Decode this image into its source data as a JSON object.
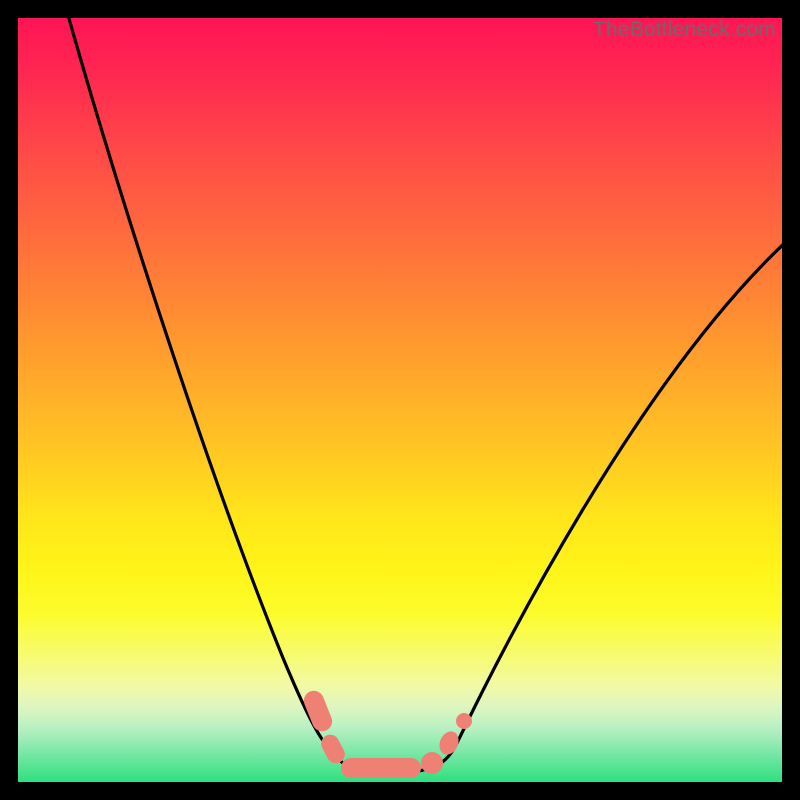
{
  "watermark": {
    "text": "TheBottleneck.com"
  },
  "chart_data": {
    "type": "line",
    "title": "",
    "xlabel": "",
    "ylabel": "",
    "xlim": [
      0,
      100
    ],
    "ylim": [
      0,
      100
    ],
    "grid": false,
    "series": [
      {
        "name": "bottleneck-curve",
        "x": [
          6,
          10,
          14,
          18,
          22,
          26,
          30,
          34,
          36,
          38,
          40,
          43,
          46,
          48,
          51,
          54,
          56,
          60,
          64,
          68,
          72,
          76,
          80,
          84,
          88,
          92,
          96,
          100
        ],
        "values": [
          100,
          90,
          80,
          70,
          60,
          50,
          41,
          32,
          27,
          22,
          16,
          9,
          4,
          2,
          1,
          1,
          2,
          5,
          10,
          16,
          23,
          30,
          37,
          44,
          51,
          58,
          64,
          71
        ]
      }
    ],
    "annotations": [
      {
        "name": "valley-marker",
        "x_range": [
          38,
          57
        ],
        "style": "salmon-rounded"
      }
    ],
    "background": {
      "type": "vertical-gradient",
      "stops": [
        {
          "pos": 0.0,
          "color": "#ff1455"
        },
        {
          "pos": 0.5,
          "color": "#ffc020"
        },
        {
          "pos": 0.75,
          "color": "#fff418"
        },
        {
          "pos": 1.0,
          "color": "#2fe07e"
        }
      ]
    }
  }
}
